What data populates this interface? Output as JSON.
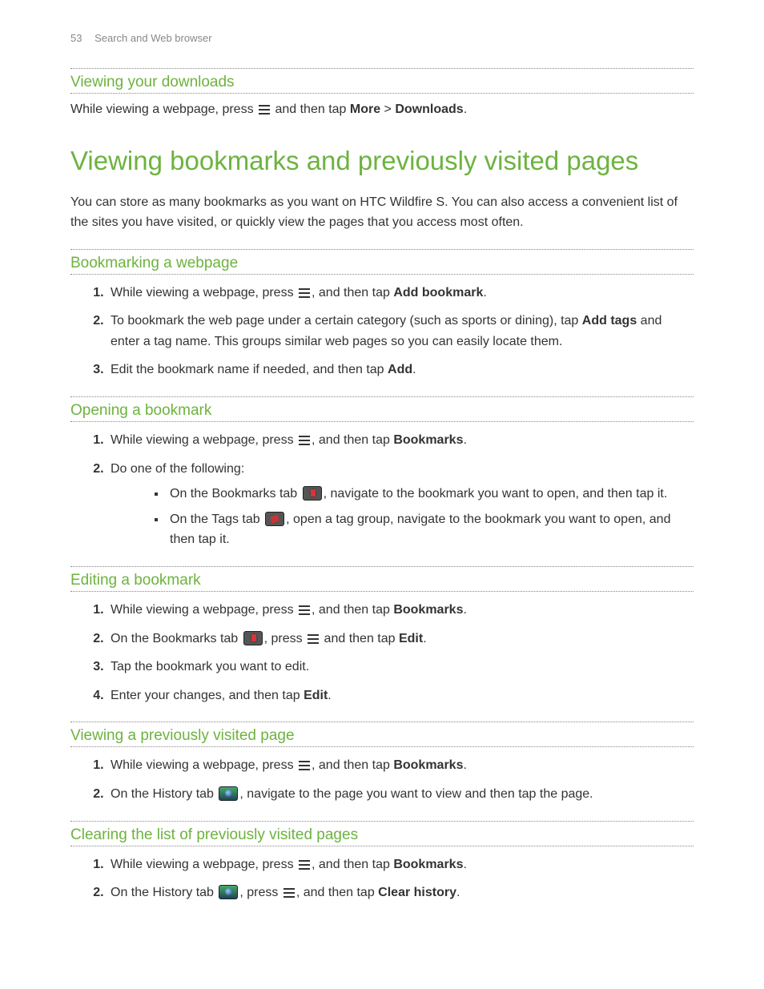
{
  "header": {
    "page_num": "53",
    "section": "Search and Web browser"
  },
  "s1": {
    "title": "Viewing your downloads",
    "p1a": "While viewing a webpage, press ",
    "p1b": " and then tap ",
    "more": "More",
    "gt": " > ",
    "downloads": "Downloads",
    "period": "."
  },
  "h1": "Viewing bookmarks and previously visited pages",
  "intro": "You can store as many bookmarks as you want on HTC Wildfire S. You can also access a convenient list of the sites you have visited, or quickly view the pages that you access most often.",
  "s2": {
    "title": "Bookmarking a webpage",
    "li1a": "While viewing a webpage, press ",
    "li1b": ", and then tap ",
    "add_bookmark": "Add bookmark",
    "li2a": "To bookmark the web page under a certain category (such as sports or dining), tap ",
    "add_tags": "Add tags",
    "li2b": " and enter a tag name. This groups similar web pages so you can easily locate them.",
    "li3a": "Edit the bookmark name if needed, and then tap ",
    "add": "Add"
  },
  "s3": {
    "title": "Opening a bookmark",
    "li1a": "While viewing a webpage, press ",
    "li1b": ", and then tap ",
    "bookmarks": "Bookmarks",
    "li2": "Do one of the following:",
    "b1a": "On the Bookmarks tab ",
    "b1b": ", navigate to the bookmark you want to open, and then tap it.",
    "b2a": "On the Tags tab ",
    "b2b": ", open a tag group, navigate to the bookmark you want to open, and then tap it."
  },
  "s4": {
    "title": "Editing a bookmark",
    "li1a": "While viewing a webpage, press ",
    "li1b": ", and then tap ",
    "bookmarks": "Bookmarks",
    "li2a": "On the Bookmarks tab ",
    "li2b": ", press ",
    "li2c": " and then tap ",
    "edit": "Edit",
    "li3": "Tap the bookmark you want to edit.",
    "li4a": "Enter your changes, and then tap ",
    "edit2": "Edit"
  },
  "s5": {
    "title": "Viewing a previously visited page",
    "li1a": "While viewing a webpage, press ",
    "li1b": ", and then tap ",
    "bookmarks": "Bookmarks",
    "li2a": "On the History tab ",
    "li2b": ", navigate to the page you want to view and then tap the page."
  },
  "s6": {
    "title": "Clearing the list of previously visited pages",
    "li1a": "While viewing a webpage, press ",
    "li1b": ", and then tap ",
    "bookmarks": "Bookmarks",
    "li2a": "On the History tab ",
    "li2b": ", press ",
    "li2c": ", and then tap ",
    "clear": "Clear history"
  },
  "period": "."
}
